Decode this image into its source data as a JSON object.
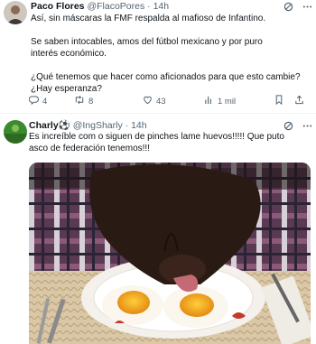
{
  "tweets": [
    {
      "author": "Paco Flores",
      "handle": "@FlacoPores",
      "separator": "·",
      "time": "14h",
      "paragraphs": [
        "Así, sin máscaras la FMF respalda al mafioso de Infantino.",
        "Se saben intocables, amos del fútbol mexicano y por puro interés económico.",
        "¿Qué tenemos que hacer como aficionados para que esto cambie? ¿Hay esperanza?"
      ],
      "actions": {
        "replies": "4",
        "retweets": "8",
        "likes": "43",
        "views": "1 mil"
      }
    },
    {
      "author": "Charly⚽️",
      "handle": "@IngSharly",
      "separator": "·",
      "time": "14h",
      "text": "Es increíble com o siguen de pinches lame huevos!!!!! Que puto asco de federación tenemos!!!"
    }
  ],
  "icons": {
    "reply": "reply-icon",
    "retweet": "retweet-icon",
    "like": "heart-icon",
    "views": "views-icon",
    "bookmark": "bookmark-icon",
    "share": "share-icon",
    "grok": "grok-icon",
    "more": "more-icon"
  },
  "colors": {
    "text": "#0f1419",
    "secondary": "#536471",
    "divider": "#eff3f4"
  }
}
